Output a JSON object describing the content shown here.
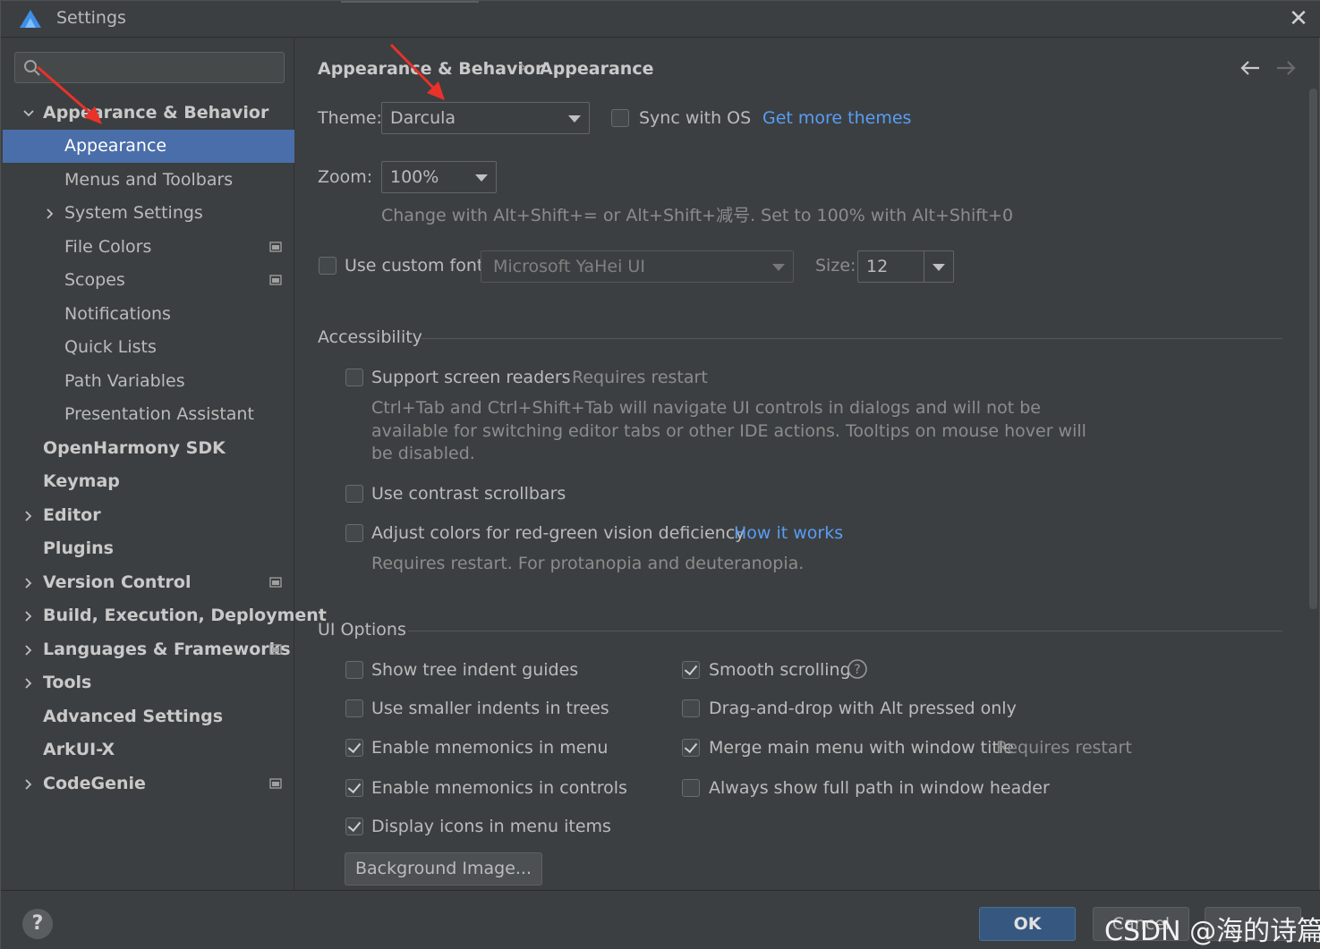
{
  "window": {
    "title": "Settings"
  },
  "sidebar": {
    "search_placeholder": "",
    "items": [
      {
        "label": "Appearance & Behavior",
        "bold": true,
        "expanded": true
      },
      {
        "label": "Appearance",
        "selected": true
      },
      {
        "label": "Menus and Toolbars"
      },
      {
        "label": "System Settings"
      },
      {
        "label": "File Colors"
      },
      {
        "label": "Scopes"
      },
      {
        "label": "Notifications"
      },
      {
        "label": "Quick Lists"
      },
      {
        "label": "Path Variables"
      },
      {
        "label": "Presentation Assistant"
      },
      {
        "label": "OpenHarmony SDK",
        "bold": true
      },
      {
        "label": "Keymap",
        "bold": true
      },
      {
        "label": "Editor",
        "bold": true
      },
      {
        "label": "Plugins",
        "bold": true
      },
      {
        "label": "Version Control",
        "bold": true
      },
      {
        "label": "Build, Execution, Deployment",
        "bold": true
      },
      {
        "label": "Languages & Frameworks",
        "bold": true
      },
      {
        "label": "Tools",
        "bold": true
      },
      {
        "label": "Advanced Settings",
        "bold": true
      },
      {
        "label": "ArkUI-X",
        "bold": true
      },
      {
        "label": "CodeGenie",
        "bold": true
      }
    ]
  },
  "breadcrumb": {
    "parent": "Appearance & Behavior",
    "separator": "›",
    "current": "Appearance"
  },
  "theme": {
    "label": "Theme:",
    "value": "Darcula",
    "sync_label": "Sync with OS",
    "sync_checked": false,
    "more_link": "Get more themes"
  },
  "zoom": {
    "label": "Zoom:",
    "value": "100%",
    "hint": "Change with Alt+Shift+= or Alt+Shift+减号. Set to 100% with Alt+Shift+0"
  },
  "font": {
    "checkbox_label": "Use custom font:",
    "checked": false,
    "value": "Microsoft YaHei UI",
    "size_label": "Size:",
    "size_value": "12"
  },
  "accessibility": {
    "header": "Accessibility",
    "screen_readers": {
      "label": "Support screen readers",
      "checked": false,
      "note": "Requires restart",
      "desc1": "Ctrl+Tab and Ctrl+Shift+Tab will navigate UI controls in dialogs and will not be",
      "desc2": "available for switching editor tabs or other IDE actions. Tooltips on mouse hover will",
      "desc3": "be disabled."
    },
    "contrast": {
      "label": "Use contrast scrollbars",
      "checked": false
    },
    "colorblind": {
      "label": "Adjust colors for red-green vision deficiency",
      "checked": false,
      "link": "How it works",
      "desc": "Requires restart. For protanopia and deuteranopia."
    }
  },
  "ui_options": {
    "header": "UI Options",
    "left": [
      {
        "label": "Show tree indent guides",
        "checked": false
      },
      {
        "label": "Use smaller indents in trees",
        "checked": false
      },
      {
        "label": "Enable mnemonics in menu",
        "checked": true
      },
      {
        "label": "Enable mnemonics in controls",
        "checked": true
      },
      {
        "label": "Display icons in menu items",
        "checked": true
      }
    ],
    "right": [
      {
        "label": "Smooth scrolling",
        "checked": true
      },
      {
        "label": "Drag-and-drop with Alt pressed only",
        "checked": false
      },
      {
        "label": "Merge main menu with window title",
        "checked": true,
        "note": "Requires restart"
      },
      {
        "label": "Always show full path in window header",
        "checked": false
      }
    ],
    "background_button": "Background Image..."
  },
  "footer": {
    "help": "?",
    "ok": "OK",
    "cancel": "Cancel",
    "watermark": "CSDN @海的诗篇_"
  },
  "colors": {
    "selection": "#4a6ea9",
    "link": "#589df6",
    "ok_button": "#365880",
    "annotation_arrow": "#e8322a"
  }
}
